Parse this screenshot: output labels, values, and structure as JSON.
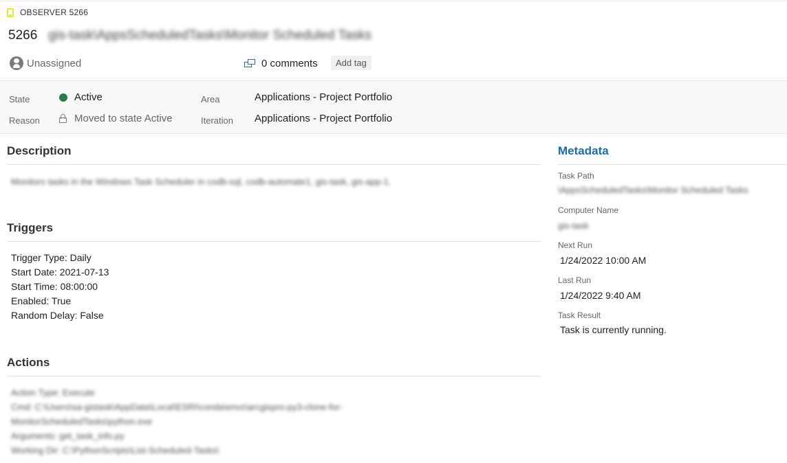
{
  "header": {
    "work_item_type": "OBSERVER 5266",
    "id": "5266",
    "title": "gis-task\\AppsScheduledTasks\\Monitor Scheduled Tasks",
    "assignee": "Unassigned",
    "comments": "0 comments",
    "add_tag": "Add tag",
    "type_color": "#e8e83a"
  },
  "fields": {
    "state_label": "State",
    "state_value": "Active",
    "state_color": "#2b7a4b",
    "reason_label": "Reason",
    "reason_value": "Moved to state Active",
    "area_label": "Area",
    "area_value": "Applications - Project Portfolio",
    "iteration_label": "Iteration",
    "iteration_value": "Applications - Project Portfolio"
  },
  "description": {
    "title": "Description",
    "text": "Monitors tasks in the Windows Task Scheduler in codb-sql, codb-automate1, gis-task, gis-app-1."
  },
  "triggers": {
    "title": "Triggers",
    "lines": [
      "Trigger Type: Daily",
      "Start Date: 2021-07-13",
      "Start Time: 08:00:00",
      "Enabled: True",
      "Random Delay: False"
    ]
  },
  "actions": {
    "title": "Actions",
    "lines": [
      "Action Type: Execute",
      "Cmd: C:\\Users\\sa-gistask\\AppData\\Local\\ESRI\\conda\\envs\\arcgispro-py3-clone-for-",
      "MonitorScheduledTasks\\python.exe",
      "Arguments: get_task_info.py",
      "Working Dir: C:\\PythonScripts\\List-Scheduled-Tasks\\"
    ]
  },
  "metadata": {
    "title": "Metadata",
    "task_path_label": "Task Path",
    "task_path_value": "\\AppsScheduledTasks\\Monitor Scheduled Tasks",
    "computer_name_label": "Computer Name",
    "computer_name_value": "gis-task",
    "next_run_label": "Next Run",
    "next_run_value": "1/24/2022 10:00 AM",
    "last_run_label": "Last Run",
    "last_run_value": "1/24/2022 9:40 AM",
    "task_result_label": "Task Result",
    "task_result_value": "Task is currently running.",
    "accent_color": "#1e6aa8"
  }
}
